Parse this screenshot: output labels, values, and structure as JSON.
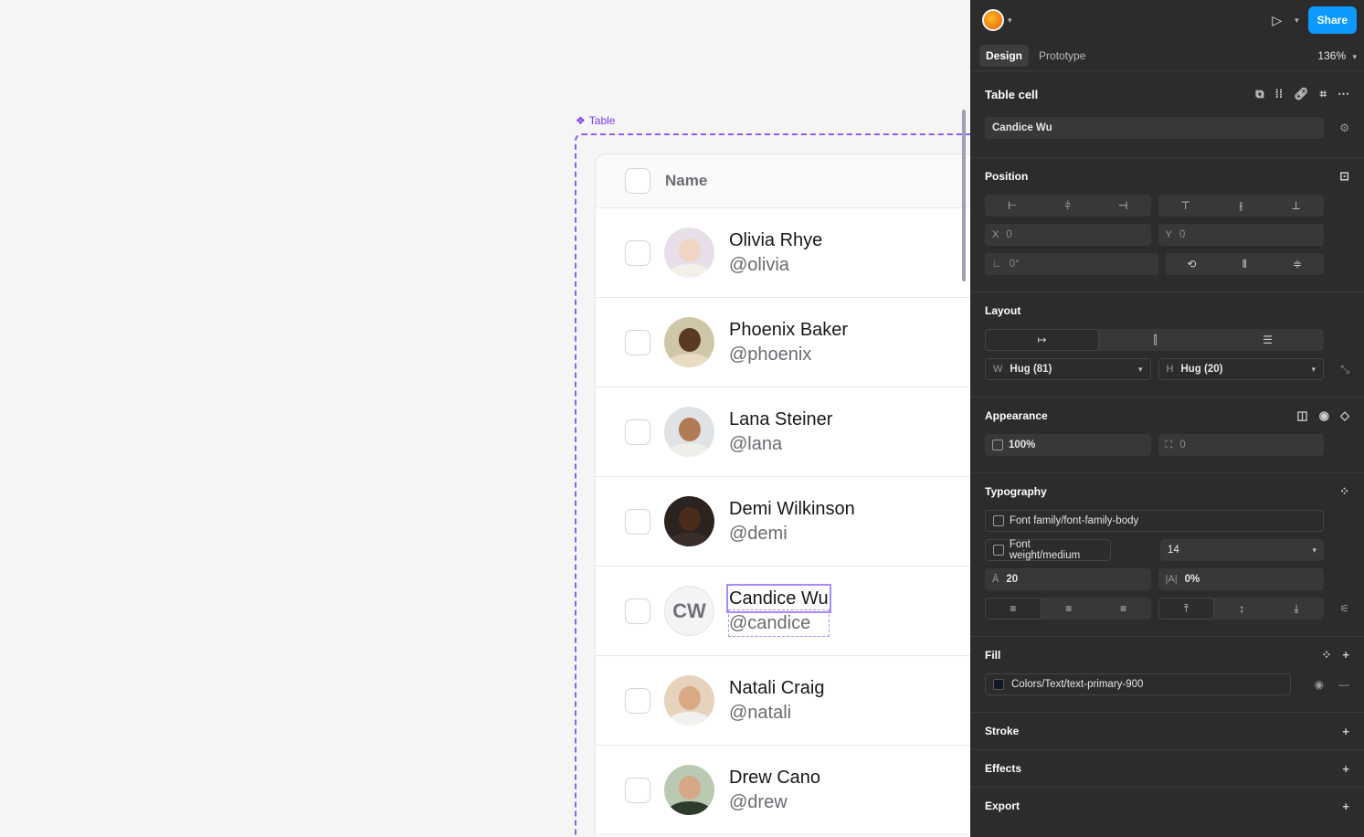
{
  "canvas": {
    "frame_label": "Table",
    "table": {
      "header_label": "Name",
      "rows": [
        {
          "name": "Olivia Rhye",
          "handle": "@olivia",
          "avatar": "photo",
          "skin": "#f0d4c4",
          "bg": "#e6dfe8",
          "shirt": "#f5efe9"
        },
        {
          "name": "Phoenix Baker",
          "handle": "@phoenix",
          "avatar": "photo",
          "skin": "#5b3a25",
          "bg": "#cfc7a8",
          "shirt": "#e8dcc2"
        },
        {
          "name": "Lana Steiner",
          "handle": "@lana",
          "avatar": "photo",
          "skin": "#b07a55",
          "bg": "#dfe3e6",
          "shirt": "#eeeeea"
        },
        {
          "name": "Demi Wilkinson",
          "handle": "@demi",
          "avatar": "photo",
          "skin": "#4a2b1c",
          "bg": "#2b2320",
          "shirt": "#3a2e28"
        },
        {
          "name": "Candice Wu",
          "handle": "@candice",
          "avatar": "initials",
          "initials": "CW"
        },
        {
          "name": "Natali Craig",
          "handle": "@natali",
          "avatar": "photo",
          "skin": "#d8a982",
          "bg": "#e7d2bd",
          "shirt": "#f1f1ee"
        },
        {
          "name": "Drew Cano",
          "handle": "@drew",
          "avatar": "photo",
          "skin": "#d6a887",
          "bg": "#b9c9b2",
          "shirt": "#2e3a2b"
        }
      ]
    }
  },
  "panel": {
    "share_label": "Share",
    "tabs": [
      "Design",
      "Prototype"
    ],
    "zoom": "136%",
    "component": {
      "title": "Table cell",
      "layer_name": "Candice Wu"
    },
    "position": {
      "title": "Position",
      "x_label": "X",
      "x_value": "0",
      "y_label": "Y",
      "y_value": "0",
      "rotation": "0°"
    },
    "layout": {
      "title": "Layout",
      "w_label": "W",
      "w_value": "Hug (81)",
      "h_label": "H",
      "h_value": "Hug (20)"
    },
    "appearance": {
      "title": "Appearance",
      "opacity": "100%",
      "radius": "0"
    },
    "typography": {
      "title": "Typography",
      "font_family": "Font family/font-family-body",
      "font_weight": "Font weight/medium",
      "font_size": "14",
      "line_height": "20",
      "letter_spacing": "0%"
    },
    "fill": {
      "title": "Fill",
      "value": "Colors/Text/text-primary-900",
      "color": "#101828"
    },
    "stroke": {
      "title": "Stroke"
    },
    "effects": {
      "title": "Effects"
    },
    "export": {
      "title": "Export"
    }
  }
}
